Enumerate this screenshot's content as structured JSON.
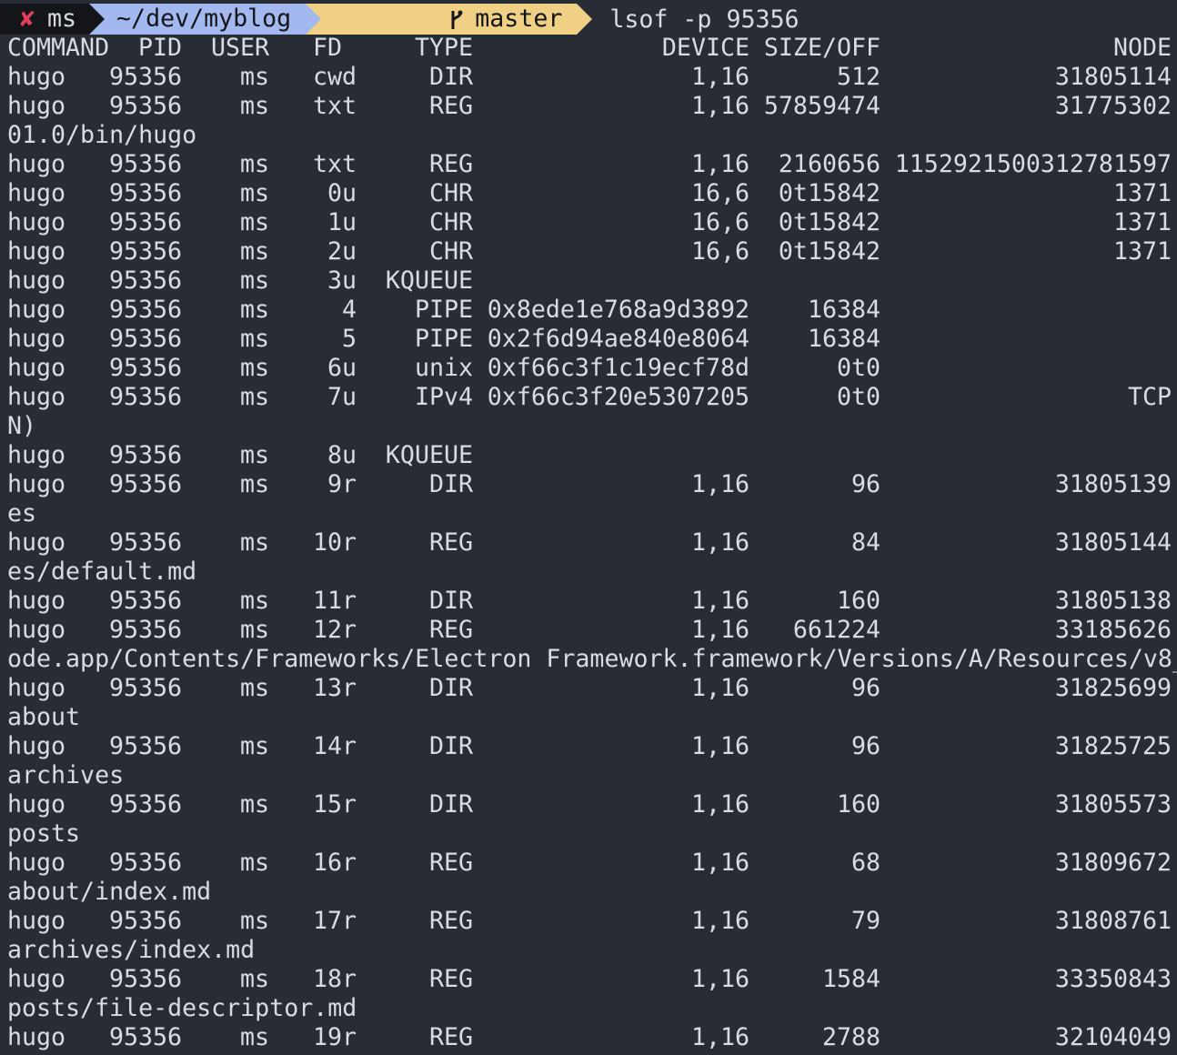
{
  "prompt": {
    "status_icon": "✘",
    "user": "ms",
    "directory": "~/dev/myblog",
    "branch_icon": "git-branch-icon",
    "branch": "master",
    "command": "lsof -p 95356"
  },
  "colors": {
    "background": "#282c34",
    "text": "#d8dce4",
    "status_segment": "#131519",
    "status_error": "#e2405a",
    "dir_segment": "#a4b8f0",
    "git_segment": "#f0d084"
  },
  "table": {
    "headers": {
      "command": "COMMAND",
      "pid": "PID",
      "user": "USER",
      "fd": "FD",
      "type": "TYPE",
      "device": "DEVICE",
      "size": "SIZE/OFF",
      "node": "NODE"
    },
    "rows": [
      {
        "command": "hugo",
        "pid": "95356",
        "user": "ms",
        "fd": "cwd",
        "type": "DIR",
        "device": "1,16",
        "size": "512",
        "node": "31805114",
        "wrap": ""
      },
      {
        "command": "hugo",
        "pid": "95356",
        "user": "ms",
        "fd": "txt",
        "type": "REG",
        "device": "1,16",
        "size": "57859474",
        "node": "31775302",
        "wrap": "01.0/bin/hugo"
      },
      {
        "command": "hugo",
        "pid": "95356",
        "user": "ms",
        "fd": "txt",
        "type": "REG",
        "device": "1,16",
        "size": "2160656",
        "node": "1152921500312781597",
        "wrap": ""
      },
      {
        "command": "hugo",
        "pid": "95356",
        "user": "ms",
        "fd": "0u",
        "type": "CHR",
        "device": "16,6",
        "size": "0t15842",
        "node": "1371",
        "wrap": ""
      },
      {
        "command": "hugo",
        "pid": "95356",
        "user": "ms",
        "fd": "1u",
        "type": "CHR",
        "device": "16,6",
        "size": "0t15842",
        "node": "1371",
        "wrap": ""
      },
      {
        "command": "hugo",
        "pid": "95356",
        "user": "ms",
        "fd": "2u",
        "type": "CHR",
        "device": "16,6",
        "size": "0t15842",
        "node": "1371",
        "wrap": ""
      },
      {
        "command": "hugo",
        "pid": "95356",
        "user": "ms",
        "fd": "3u",
        "type": "KQUEUE",
        "device": "",
        "size": "",
        "node": "",
        "wrap": ""
      },
      {
        "command": "hugo",
        "pid": "95356",
        "user": "ms",
        "fd": "4",
        "type": "PIPE",
        "device": "0x8ede1e768a9d3892",
        "size": "16384",
        "node": "",
        "wrap": ""
      },
      {
        "command": "hugo",
        "pid": "95356",
        "user": "ms",
        "fd": "5",
        "type": "PIPE",
        "device": "0x2f6d94ae840e8064",
        "size": "16384",
        "node": "",
        "wrap": ""
      },
      {
        "command": "hugo",
        "pid": "95356",
        "user": "ms",
        "fd": "6u",
        "type": "unix",
        "device": "0xf66c3f1c19ecf78d",
        "size": "0t0",
        "node": "",
        "wrap": ""
      },
      {
        "command": "hugo",
        "pid": "95356",
        "user": "ms",
        "fd": "7u",
        "type": "IPv4",
        "device": "0xf66c3f20e5307205",
        "size": "0t0",
        "node": "TCP",
        "wrap": "N)"
      },
      {
        "command": "hugo",
        "pid": "95356",
        "user": "ms",
        "fd": "8u",
        "type": "KQUEUE",
        "device": "",
        "size": "",
        "node": "",
        "wrap": ""
      },
      {
        "command": "hugo",
        "pid": "95356",
        "user": "ms",
        "fd": "9r",
        "type": "DIR",
        "device": "1,16",
        "size": "96",
        "node": "31805139",
        "wrap": "es"
      },
      {
        "command": "hugo",
        "pid": "95356",
        "user": "ms",
        "fd": "10r",
        "type": "REG",
        "device": "1,16",
        "size": "84",
        "node": "31805144",
        "wrap": "es/default.md"
      },
      {
        "command": "hugo",
        "pid": "95356",
        "user": "ms",
        "fd": "11r",
        "type": "DIR",
        "device": "1,16",
        "size": "160",
        "node": "31805138",
        "wrap": ""
      },
      {
        "command": "hugo",
        "pid": "95356",
        "user": "ms",
        "fd": "12r",
        "type": "REG",
        "device": "1,16",
        "size": "661224",
        "node": "33185626",
        "wrap": "ode.app/Contents/Frameworks/Electron Framework.framework/Versions/A/Resources/v8_"
      },
      {
        "command": "hugo",
        "pid": "95356",
        "user": "ms",
        "fd": "13r",
        "type": "DIR",
        "device": "1,16",
        "size": "96",
        "node": "31825699",
        "wrap": "about"
      },
      {
        "command": "hugo",
        "pid": "95356",
        "user": "ms",
        "fd": "14r",
        "type": "DIR",
        "device": "1,16",
        "size": "96",
        "node": "31825725",
        "wrap": "archives"
      },
      {
        "command": "hugo",
        "pid": "95356",
        "user": "ms",
        "fd": "15r",
        "type": "DIR",
        "device": "1,16",
        "size": "160",
        "node": "31805573",
        "wrap": "posts"
      },
      {
        "command": "hugo",
        "pid": "95356",
        "user": "ms",
        "fd": "16r",
        "type": "REG",
        "device": "1,16",
        "size": "68",
        "node": "31809672",
        "wrap": "about/index.md"
      },
      {
        "command": "hugo",
        "pid": "95356",
        "user": "ms",
        "fd": "17r",
        "type": "REG",
        "device": "1,16",
        "size": "79",
        "node": "31808761",
        "wrap": "archives/index.md"
      },
      {
        "command": "hugo",
        "pid": "95356",
        "user": "ms",
        "fd": "18r",
        "type": "REG",
        "device": "1,16",
        "size": "1584",
        "node": "33350843",
        "wrap": "posts/file-descriptor.md"
      },
      {
        "command": "hugo",
        "pid": "95356",
        "user": "ms",
        "fd": "19r",
        "type": "REG",
        "device": "1,16",
        "size": "2788",
        "node": "32104049",
        "wrap": ""
      }
    ]
  }
}
